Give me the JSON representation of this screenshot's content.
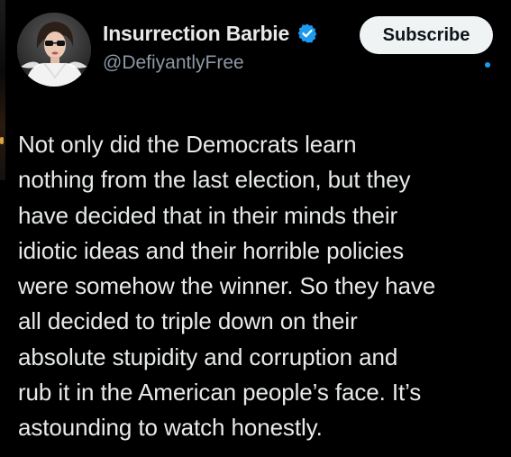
{
  "author": {
    "display_name": "Insurrection Barbie",
    "handle": "@DefiyantlyFree",
    "verified": true,
    "avatar_icon": "avatar-woman-sunglasses"
  },
  "actions": {
    "subscribe_label": "Subscribe"
  },
  "post": {
    "lines": [
      "Not only did the Democrats learn",
      "nothing from the last election, but they",
      "have decided that in their minds their",
      "idiotic ideas and their horrible policies",
      "were somehow the winner. So they have",
      "all decided to triple down on their",
      "absolute stupidity and corruption and",
      "rub it in the American people’s face. It’s",
      "astounding to watch honestly."
    ]
  },
  "colors": {
    "background": "#000000",
    "text": "#e7e9ea",
    "muted": "#8b98a5",
    "accent": "#1d9bf0",
    "button_bg": "#eff3f4"
  }
}
